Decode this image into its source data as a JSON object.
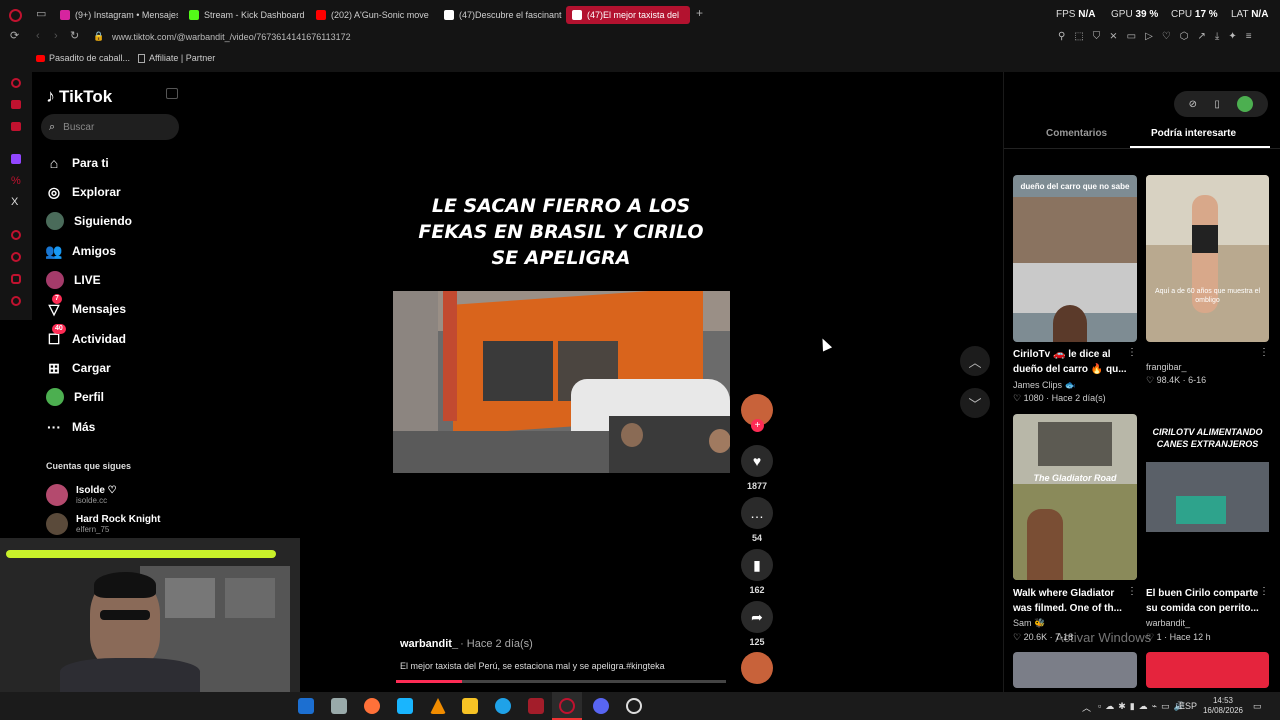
{
  "browser": {
    "tabs": [
      {
        "label": "(9+) Instagram • Mensajes",
        "color": "#d6249f",
        "active": false
      },
      {
        "label": "Stream - Kick Dashboard",
        "color": "#53fc18",
        "active": false
      },
      {
        "label": "(202) A'Gun-Sonic move |",
        "color": "#ff0000",
        "active": false
      },
      {
        "label": "(47)Descubre el fascinante",
        "color": "#ffffff",
        "active": false
      },
      {
        "label": "(47)El mejor taxista del",
        "color": "#ffffff",
        "active": true
      }
    ],
    "new_tab": "+",
    "stats": {
      "fps_label": "FPS",
      "fps_value": "N/A",
      "gpu_label": "GPU",
      "gpu_value": "39 %",
      "cpu_label": "CPU",
      "cpu_value": "17 %",
      "lat_label": "LAT",
      "lat_value": "N/A"
    },
    "url": "www.tiktok.com/@warbandit_/video/7673614141676113172",
    "bookmarks": [
      {
        "label": "Pasadito de caball...",
        "icon": "youtube-icon"
      },
      {
        "label": "Affiliate | Partner",
        "icon": "page-icon"
      }
    ],
    "accent": "#b3122f"
  },
  "tiktok": {
    "logo": "TikTok",
    "search_placeholder": "Buscar",
    "nav": [
      {
        "label": "Para ti",
        "icon": "home-icon",
        "glyph": "⌂"
      },
      {
        "label": "Explorar",
        "icon": "compass-icon",
        "glyph": "◎"
      },
      {
        "label": "Siguiendo",
        "icon": "following-avatar-icon",
        "glyph": ""
      },
      {
        "label": "Amigos",
        "icon": "friends-icon",
        "glyph": "👥"
      },
      {
        "label": "LIVE",
        "icon": "live-avatar-icon",
        "glyph": ""
      },
      {
        "label": "Mensajes",
        "icon": "messages-icon",
        "glyph": "▽",
        "badge": "7"
      },
      {
        "label": "Actividad",
        "icon": "activity-icon",
        "glyph": "☐",
        "badge": "40"
      },
      {
        "label": "Cargar",
        "icon": "upload-icon",
        "glyph": "⊞"
      },
      {
        "label": "Perfil",
        "icon": "profile-avatar-icon",
        "glyph": ""
      },
      {
        "label": "Más",
        "icon": "more-icon",
        "glyph": "···"
      }
    ],
    "following_heading": "Cuentas que sigues",
    "following": [
      {
        "name": "Isolde ♡",
        "handle": "isolde.cc"
      },
      {
        "name": "Hard Rock Knight",
        "handle": "elfern_75"
      }
    ],
    "video": {
      "title": "LE SACAN FIERRO A LOS FEKAS EN BRASIL Y CIRILO SE APELIGRA",
      "author": "warbandit_",
      "date": " · Hace 2 día(s)",
      "caption": "El mejor taxista del Perú, se estaciona mal y se apeligra.#kingteka",
      "progress": 0.2
    },
    "actions": {
      "likes": "1877",
      "comments": "54",
      "saves": "162",
      "shares": "125"
    },
    "right": {
      "tab_comments": "Comentarios",
      "tab_suggest": "Podría interesarte",
      "cards": [
        {
          "title": "CiriloTv 🚗 le dice al dueño del carro 🔥 qu...",
          "author": "James Clips 🐟",
          "stats": "♡ 1080 · Hace 2 día(s)",
          "overlay": "dueño del carro que no sabe"
        },
        {
          "title": "",
          "author": "frangibar_",
          "stats": "♡ 98.4K · 6-16",
          "overlay": "Aquí a de 60 años que muestra el ombligo"
        },
        {
          "title": "Walk where Gladiator was filmed. One of th...",
          "author": "Sam 🐝",
          "stats": "♡ 20.6K · 7-18",
          "overlay": "The Gladiator Road"
        },
        {
          "title": "El buen Cirilo comparte su comida con perrito...",
          "author": "warbandit_",
          "stats": "♡ 1 · Hace 12 h",
          "overlay": "CIRILOTV ALIMENTANDO CANES EXTRANJEROS"
        }
      ],
      "watermark": "Activar Windows"
    }
  },
  "taskbar": {
    "lang": "ESP",
    "time": "14:53",
    "date": "16/08/2026"
  }
}
